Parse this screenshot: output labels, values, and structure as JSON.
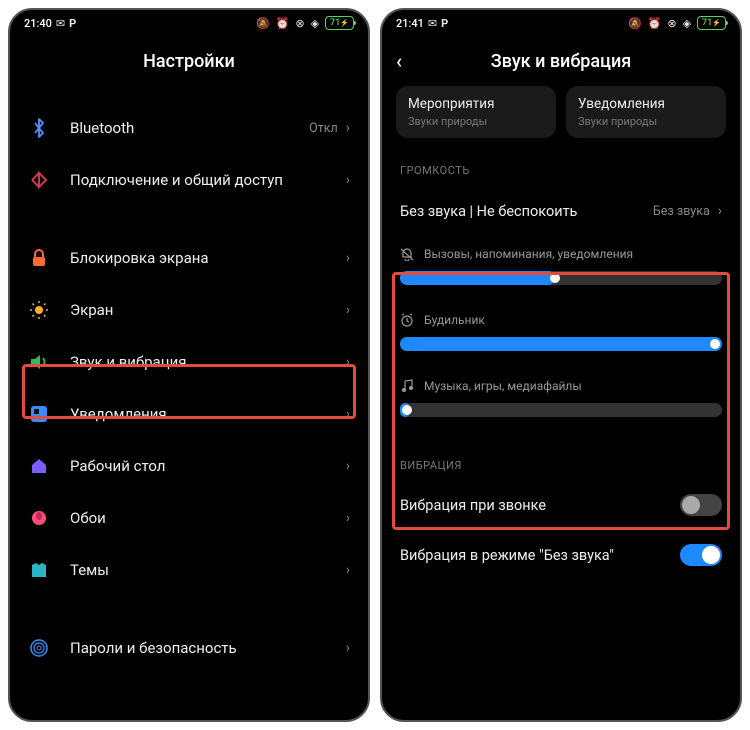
{
  "left": {
    "status": {
      "time": "21:40",
      "battery": "71"
    },
    "title": "Настройки",
    "items": [
      {
        "label": "Bluetooth",
        "value": "Откл",
        "icon": "bluetooth",
        "color": "#5a8fff"
      },
      {
        "label": "Подключение и общий доступ",
        "value": "",
        "icon": "share",
        "color": "#e63860"
      }
    ],
    "items2": [
      {
        "label": "Блокировка экрана",
        "icon": "lock",
        "color": "#ff6b35"
      },
      {
        "label": "Экран",
        "icon": "sun",
        "color": "#ffb020"
      },
      {
        "label": "Звук и вибрация",
        "icon": "sound",
        "color": "#2dbd5a"
      },
      {
        "label": "Уведомления",
        "icon": "notif",
        "color": "#3a8dff"
      },
      {
        "label": "Рабочий стол",
        "icon": "home",
        "color": "#7b5cff"
      },
      {
        "label": "Обои",
        "icon": "wallpaper",
        "color": "#ff4d7d"
      },
      {
        "label": "Темы",
        "icon": "themes",
        "color": "#2db5c4"
      }
    ],
    "items3": [
      {
        "label": "Пароли и безопасность",
        "icon": "fingerprint",
        "color": "#3a8dff"
      }
    ]
  },
  "right": {
    "status": {
      "time": "21:41",
      "battery": "71"
    },
    "title": "Звук и вибрация",
    "cards": [
      {
        "title": "Мероприятия",
        "sub": "Звуки природы"
      },
      {
        "title": "Уведомления",
        "sub": "Звуки природы"
      }
    ],
    "section_volume": "ГРОМКОСТЬ",
    "silent_row": {
      "label": "Без звука | Не беспокоить",
      "value": "Без звука"
    },
    "sliders": [
      {
        "label": "Вызовы, напоминания, уведомления",
        "icon": "bell-off",
        "pct": 48
      },
      {
        "label": "Будильник",
        "icon": "alarm",
        "pct": 100
      },
      {
        "label": "Музыка, игры, медиафайлы",
        "icon": "music",
        "pct": 3
      }
    ],
    "section_vibration": "ВИБРАЦИЯ",
    "toggles": [
      {
        "label": "Вибрация при звонке",
        "on": false
      },
      {
        "label": "Вибрация в режиме \"Без звука\"",
        "on": true
      }
    ]
  }
}
